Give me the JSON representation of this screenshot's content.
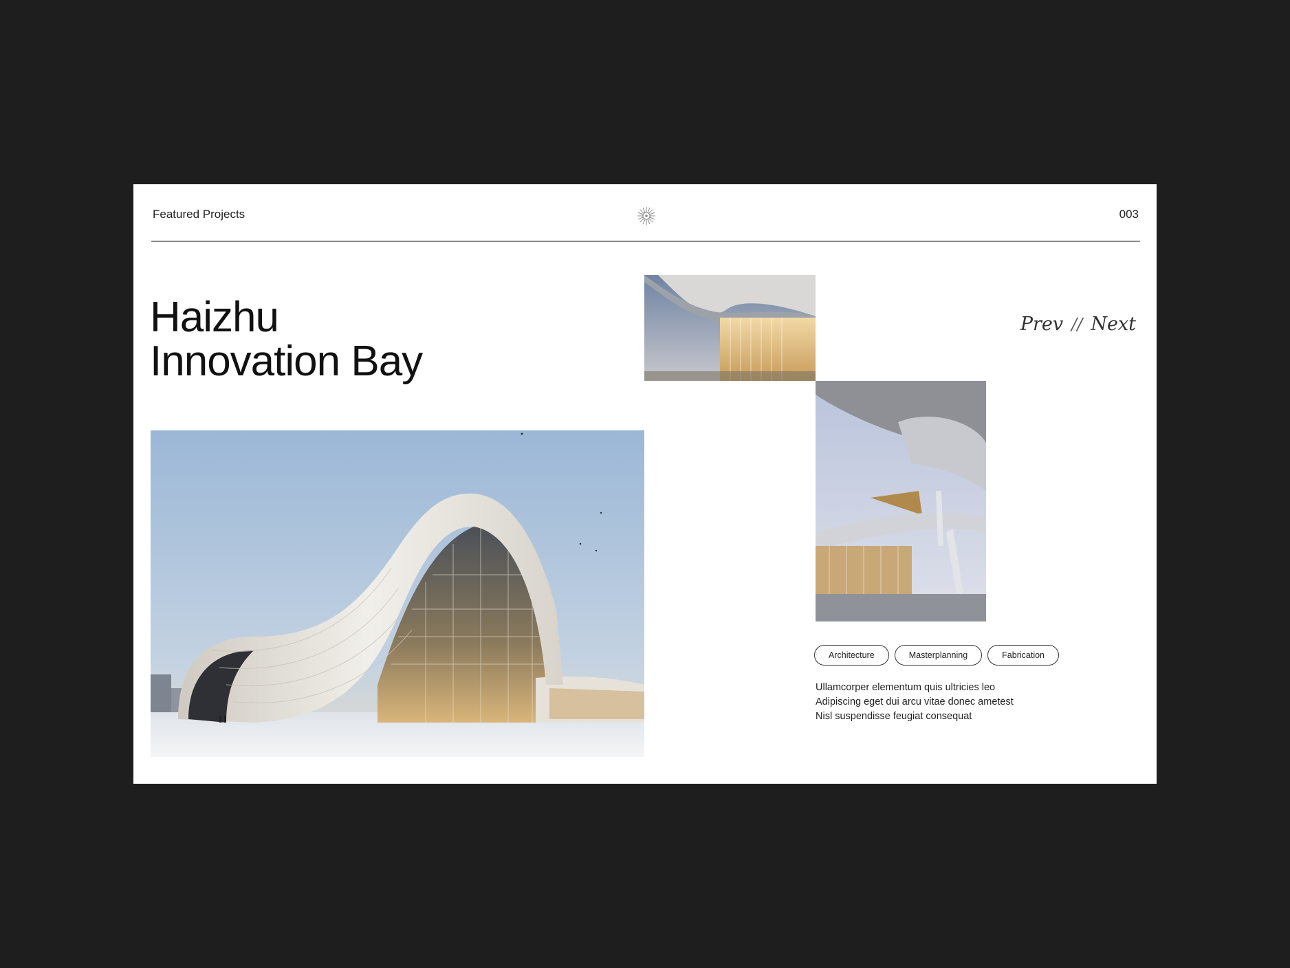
{
  "header": {
    "section_label": "Featured Projects",
    "page_number": "003",
    "logo_icon": "sunburst-logo-icon"
  },
  "project": {
    "title_line1": "Haizhu",
    "title_line2": "Innovation Bay"
  },
  "pager": {
    "prev_label": "Prev",
    "separator": "//",
    "next_label": "Next"
  },
  "tags": [
    "Architecture",
    "Masterplanning",
    "Fabrication"
  ],
  "description": [
    "Ullamcorper elementum quis ultricies leo",
    "Adipiscing eget dui arcu vitae donec ametest",
    "Nisl suspendisse feugiat consequat"
  ],
  "colors": {
    "page_background": "#1e1e1e",
    "slide_background": "#ffffff",
    "text": "#111111",
    "sky": "#a9bfd8",
    "building": "#e9e6df",
    "glass_glow": "#d7b47a"
  }
}
